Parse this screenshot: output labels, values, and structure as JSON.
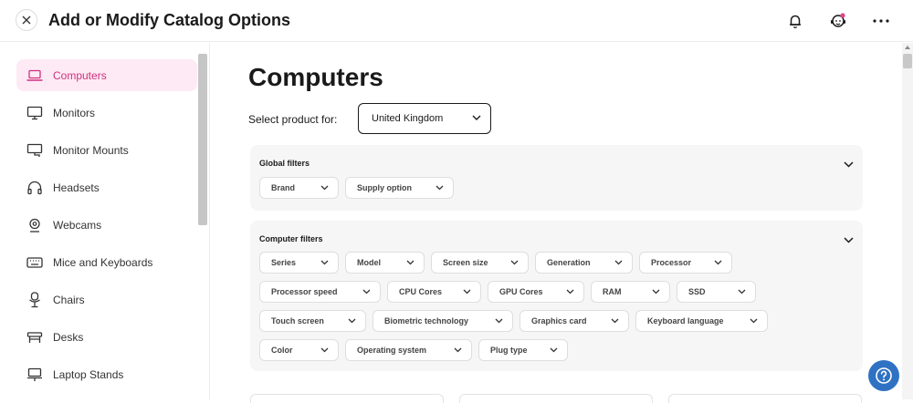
{
  "header": {
    "title": "Add or Modify Catalog Options",
    "close_icon": "close-icon",
    "icons": [
      "bell-icon",
      "support-agent-icon",
      "more-options-icon"
    ],
    "notification_dot_color": "#e0458b"
  },
  "sidebar": {
    "items": [
      {
        "label": "Computers",
        "icon": "laptop-icon",
        "active": true
      },
      {
        "label": "Monitors",
        "icon": "monitor-icon"
      },
      {
        "label": "Monitor Mounts",
        "icon": "monitor-mount-icon"
      },
      {
        "label": "Headsets",
        "icon": "headset-icon"
      },
      {
        "label": "Webcams",
        "icon": "webcam-icon"
      },
      {
        "label": "Mice and Keyboards",
        "icon": "keyboard-icon"
      },
      {
        "label": "Chairs",
        "icon": "chair-icon"
      },
      {
        "label": "Desks",
        "icon": "desk-icon"
      },
      {
        "label": "Laptop Stands",
        "icon": "laptop-stand-icon"
      }
    ],
    "active_color": "#d0307f",
    "active_bg": "#fdeaf4"
  },
  "main": {
    "title": "Computers",
    "select_label": "Select product for:",
    "select_value": "United Kingdom",
    "global_filters": {
      "title": "Global filters",
      "chips": [
        "Brand",
        "Supply option"
      ]
    },
    "computer_filters": {
      "title": "Computer filters",
      "rows": [
        [
          "Series",
          "Model",
          "Screen size",
          "Generation",
          "Processor"
        ],
        [
          "Processor speed",
          "CPU Cores",
          "GPU Cores",
          "RAM",
          "SSD"
        ],
        [
          "Touch screen",
          "Biometric technology",
          "Graphics card",
          "Keyboard language"
        ],
        [
          "Color",
          "Operating system",
          "Plug type"
        ]
      ]
    }
  },
  "help": {
    "icon": "help-icon",
    "color": "#2f72c4"
  }
}
